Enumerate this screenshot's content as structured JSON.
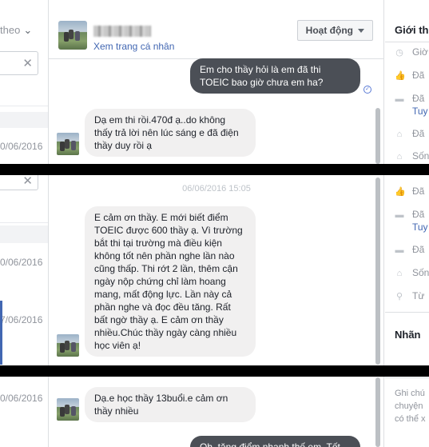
{
  "left_panel": {
    "sort_label": "theo",
    "dates": [
      "0/06/2016",
      "0/06/2016",
      "7/06/2016",
      "0/06/2016"
    ]
  },
  "chat": {
    "header": {
      "profile_link": "Xem trang cá nhân",
      "status_button": "Hoạt động"
    },
    "messages": [
      {
        "direction": "out",
        "text": "Em cho thầy hỏi là em đã thi TOEIC bao giờ chưa em ha?"
      },
      {
        "direction": "in",
        "text": "Dạ em thi rồi.470đ ạ..do không thấy trả lời nên lúc sáng e đã điện thầy duy rồi ạ"
      },
      {
        "direction": "in",
        "text": "E cảm ơn thầy. E mới biết điểm TOEIC được 600 thầy ạ. Vì trường bắt thi tại trường mà điều kiện không tốt nên phần nghe lần nào cũng thấp. Thi rớt 2 lần, thêm cận ngày nộp chứng chỉ làm hoang mang, mất động lực. Lần này cả phần nghe và đọc đều tăng. Rất bất ngờ thầy ạ. E cảm ơn thầy nhiều.Chúc thầy ngày càng nhiều học viên ạ!"
      },
      {
        "direction": "in",
        "text": "Dạ.e học thầy 13buổi.e cảm ơn thầy nhiều"
      },
      {
        "direction": "out",
        "text": "Oh, tăng điểm nhanh thế em. Tốt"
      }
    ],
    "timestamp": "06/06/2016 15:05",
    "seen_icon": "check-circle-icon"
  },
  "right_panel": {
    "title": "Giới thi",
    "rows_top": [
      {
        "icon": "clock-icon",
        "text": "Giờ"
      },
      {
        "icon": "like-icon",
        "text": "Đã"
      },
      {
        "icon": "briefcase-icon",
        "text": "Đã",
        "link": "Tuy"
      },
      {
        "icon": "home-icon",
        "text": "Đã"
      },
      {
        "icon": "home-icon",
        "text": "Sốn"
      }
    ],
    "rows_bottom": [
      {
        "icon": "like-icon",
        "text": "Đã"
      },
      {
        "icon": "briefcase-icon",
        "text": "Đã",
        "link": "Tuy"
      },
      {
        "icon": "briefcase-icon",
        "text": "Đã"
      },
      {
        "icon": "home-icon",
        "text": "Sốn"
      },
      {
        "icon": "location-icon",
        "text": "Từ"
      }
    ],
    "labels_title": "Nhãn",
    "note_lines": [
      "Ghi chú",
      "chuyện",
      "có thể x"
    ]
  },
  "colors": {
    "accent": "#4267b2",
    "outgoing_bubble": "#4b4f56",
    "incoming_bubble": "#f1f0f0"
  }
}
